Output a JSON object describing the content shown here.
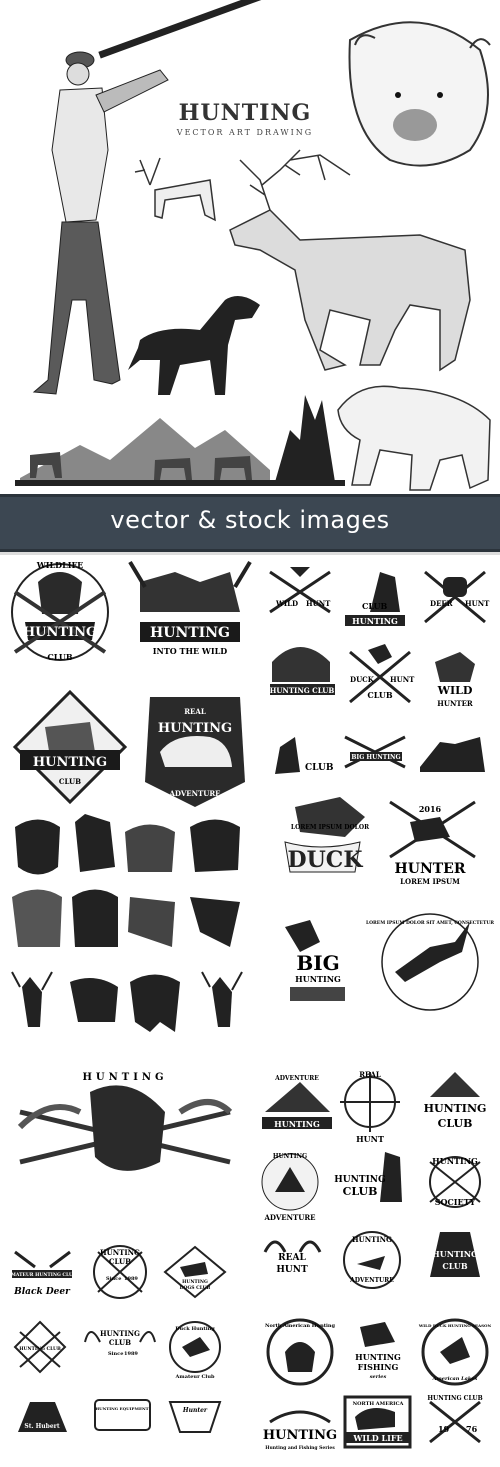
{
  "hero": {
    "title": "HUNTING",
    "subtitle": "VECTOR ART DRAWING"
  },
  "banner": {
    "text": "vector & stock images"
  },
  "section1": {
    "badges": [
      "HUNTING",
      "HUNTING",
      "HUNTING",
      "HUNTING"
    ],
    "badge_sub": [
      "CLUB",
      "INTO THE WILD",
      "CLUB",
      "ADVENTURE"
    ],
    "top_wildlife": "WILDLIFE",
    "real": "REAL"
  },
  "section2": {
    "labels": [
      "WILD",
      "HUNT",
      "CLUB",
      "HUNTING",
      "DEER",
      "HUNT",
      "HUNTING CLUB",
      "DUCK",
      "HUNT",
      "CLUB",
      "WILD",
      "HUNTER",
      "CLUB",
      "BIG HUNTING"
    ]
  },
  "section3": {
    "duck_lorem": "LOREM IPSUM DOLOR",
    "duck": "DUCK",
    "year": "2016",
    "hunter": "HUNTER",
    "hunter_lorem": "LOREM IPSUM",
    "big": "BIG",
    "big_hunting": "HUNTING",
    "consectetur": "LOREM IPSUM DOLOR SIT AMET, CONSECTETUR"
  },
  "section4": {
    "title": "HUNTING",
    "labels": [
      "ADVENTURE",
      "HUNTING",
      "REAL",
      "HUNT",
      "HUNTING",
      "CLUB",
      "HUNTING",
      "ADVENTURE",
      "HUNTING",
      "CLUB",
      "HUNTING",
      "SOCIETY",
      "REAL",
      "HUNT",
      "HUNTING",
      "ADVENTURE",
      "HUNTING",
      "CLUB"
    ]
  },
  "section5": {
    "labels": [
      "AMATEUR HUNTING CLUB",
      "Black Deer",
      "HUNTING",
      "CLUB",
      "Since",
      "1989",
      "HUNTING",
      "DOGS CLUB",
      "HUNTING CLUB",
      "HUNTING",
      "CLUB",
      "Since",
      "1989",
      "Duck Hunting",
      "Amateur Club",
      "St. Hubert",
      "HUNTING EQUIPMENT",
      "Hunter"
    ]
  },
  "section6": {
    "labels": [
      "North American Hunting",
      "HUNTING",
      "FISHING",
      "series",
      "WILD DUCK HUNTING SEASON",
      "American Lakes",
      "HUNTING",
      "Hunting and Fishing Series",
      "NORTH AMERICA",
      "WILD LIFE",
      "HUNTING CLUB",
      "19",
      "76"
    ]
  }
}
